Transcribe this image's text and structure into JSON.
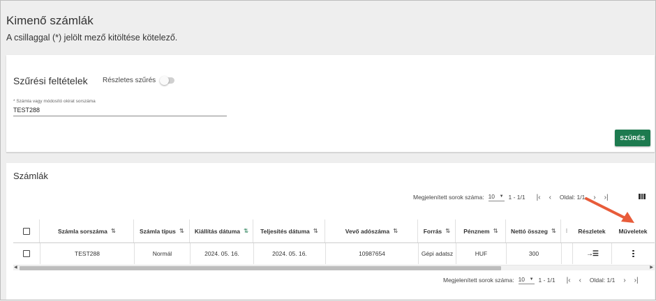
{
  "page": {
    "title": "Kimenő számlák",
    "subtitle": "A csillaggal (*) jelölt mező kitöltése kötelező."
  },
  "filter": {
    "title": "Szűrési feltételek",
    "detailed_label": "Részletes szűrés",
    "detailed_enabled": false,
    "field_label": "* Számla vagy módosító okirat sorszáma",
    "field_value": "TEST288",
    "button_label": "SZŰRÉS",
    "button_color": "#1d7a4f"
  },
  "invoices": {
    "title": "Számlák",
    "pager_label": "Megjelenített sorok száma:",
    "rows_per_page": "10",
    "range": "1 - 1/1",
    "page_label": "Oldal: 1/1",
    "columns": [
      {
        "label": "Számla sorszáma",
        "sort_icon": "sort-icon"
      },
      {
        "label": "Számla típus",
        "sort_icon": "sort-icon"
      },
      {
        "label": "Kiállítás dátuma",
        "sort_icon": "sort-asc-active-icon"
      },
      {
        "label": "Teljesítés dátuma",
        "sort_icon": "sort-icon"
      },
      {
        "label": "Vevő adószáma",
        "sort_icon": "sort-icon"
      },
      {
        "label": "Forrás",
        "sort_icon": "sort-icon"
      },
      {
        "label": "Pénznem",
        "sort_icon": "sort-icon"
      },
      {
        "label": "Nettó összeg",
        "sort_icon": "sort-icon"
      },
      {
        "label": "Részletek"
      },
      {
        "label": "Műveletek"
      }
    ],
    "rows": [
      {
        "szamla_sorszama": "TEST288",
        "szamla_tipus": "Normál",
        "kiallitas_datuma": "2024. 05. 16.",
        "teljesites_datuma": "2024. 05. 16.",
        "vevo_adoszama": "10987654",
        "forras": "Gépi adatsz",
        "penznem": "HUF",
        "netto_osszeg": "300"
      }
    ]
  },
  "colors": {
    "accent": "#1d7a4f",
    "annotation_arrow": "#e85c3a"
  }
}
